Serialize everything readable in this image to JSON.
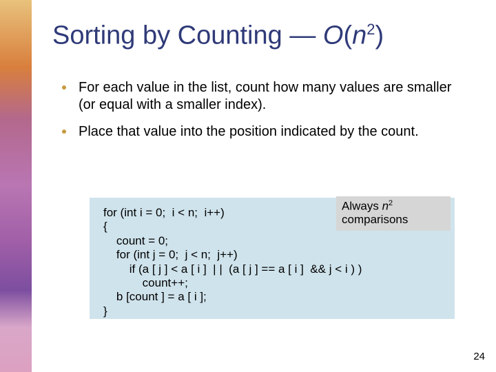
{
  "title": {
    "prefix": "Sorting by Counting — ",
    "bigO_O": "O",
    "bigO_open": "(",
    "bigO_n": "n",
    "bigO_exp": "2",
    "bigO_close": ")"
  },
  "bullets": [
    "For each value in the list, count how many values are smaller (or equal with a smaller index).",
    "Place that value into the position indicated by the count."
  ],
  "code": {
    "l1": "for (int i = 0;  i < n;  i++)",
    "l2": "{",
    "l3": "    count = 0;",
    "l4": "    for (int j = 0;  j < n;  j++)",
    "l5": "        if (a [ j ] < a [ i ]  | |  (a [ j ] == a [ i ]  && j < i ) )",
    "l6": "            count++;",
    "l7": "    b [count ] = a [ i ];",
    "l8": "}"
  },
  "note": {
    "word1": "Always ",
    "n": "n",
    "exp": "2",
    "word2": "comparisons"
  },
  "page_number": "24"
}
